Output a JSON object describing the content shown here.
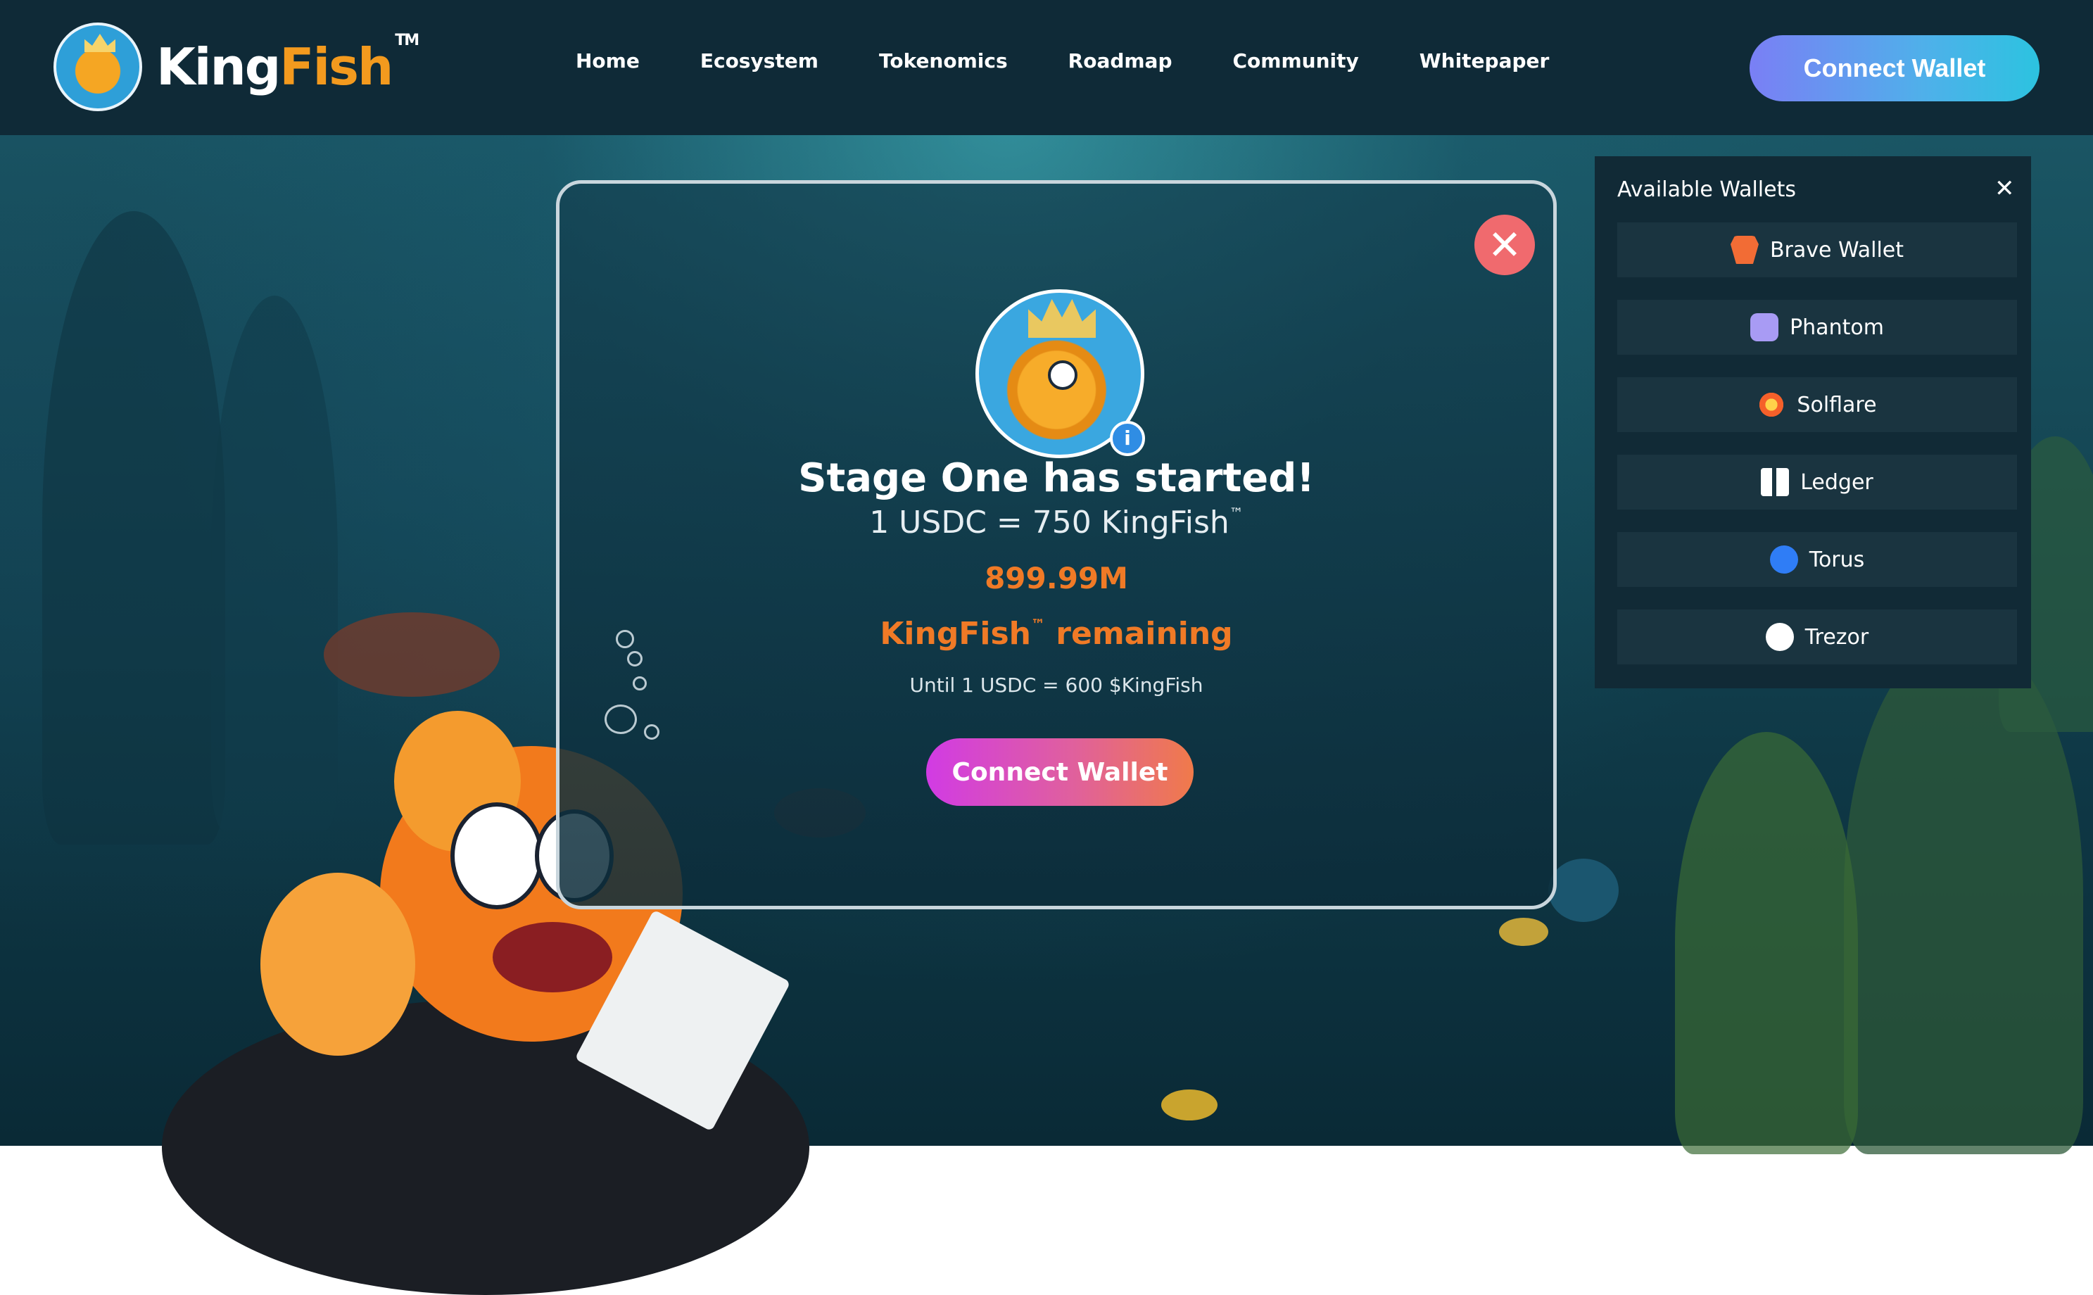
{
  "brand": {
    "name_part1": "King",
    "name_part2": "Fish",
    "tm": "TM"
  },
  "nav": {
    "items": [
      "Home",
      "Ecosystem",
      "Tokenomics",
      "Roadmap",
      "Community",
      "Whitepaper"
    ]
  },
  "header": {
    "connect_label": "Connect Wallet"
  },
  "modal": {
    "close_glyph": "✕",
    "info_glyph": "i",
    "title": "Stage One has started!",
    "rate_text": "1 USDC = 750 KingFish",
    "tm": "™",
    "amount": "899.99M",
    "remaining_text": "KingFish",
    "remaining_suffix": " remaining",
    "until": "Until 1 USDC = 600 $KingFish",
    "connect_label": "Connect Wallet"
  },
  "wallets": {
    "heading": "Available Wallets",
    "close_glyph": "✕",
    "items": [
      {
        "label": "Brave Wallet",
        "icon": "brave-icon",
        "color": "#f26c35"
      },
      {
        "label": "Phantom",
        "icon": "phantom-icon",
        "color": "#a89bf4"
      },
      {
        "label": "Solflare",
        "icon": "solflare-icon",
        "color": "#f5a623"
      },
      {
        "label": "Ledger",
        "icon": "ledger-icon",
        "color": "#ffffff"
      },
      {
        "label": "Torus",
        "icon": "torus-icon",
        "color": "#2f7df6"
      },
      {
        "label": "Trezor",
        "icon": "trezor-icon",
        "color": "#ffffff"
      }
    ]
  },
  "colors": {
    "accent_orange": "#f07a26",
    "connect_top_gradient": [
      "#7a7ff5",
      "#2cc3e0"
    ],
    "connect_modal_gradient": [
      "#d13be4",
      "#f07a4a"
    ],
    "close_red": "#f06a6e"
  }
}
